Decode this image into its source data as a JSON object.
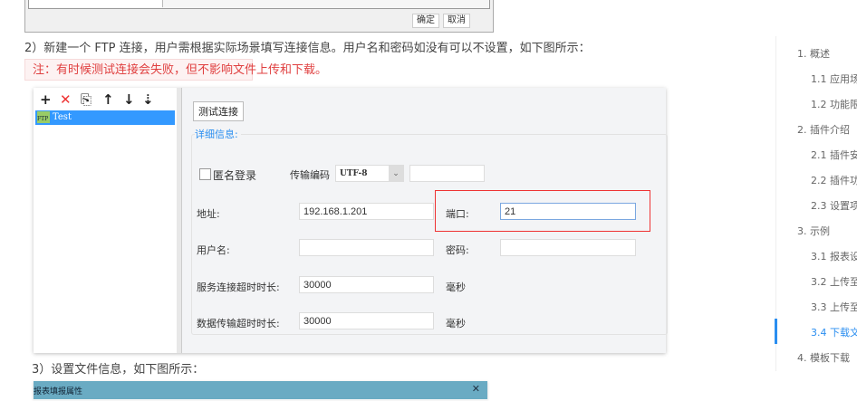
{
  "top_dialog": {
    "ok": "确定",
    "cancel": "取消"
  },
  "step2": "2）新建一个 FTP 连接，用户需根据实际场景填写连接信息。用户名和密码如没有可以不设置，如下图所示：",
  "note": "注：有时候测试连接会失败，但不影响文件上传和下载。",
  "ftp": {
    "toolbar": {
      "add": "+",
      "delete": "✕",
      "copy": "⎘",
      "up": "↑",
      "down": "↓",
      "sort": "⇣"
    },
    "connection": "Test",
    "ftp_badge": "FTP",
    "test_button": "测试连接",
    "section": "详细信息:",
    "anonymous": "匿名登录",
    "encoding_label": "传输编码",
    "encoding_value": "UTF-8",
    "address_label": "地址:",
    "address": "192.168.1.201",
    "port_label": "端口:",
    "port": "21",
    "user_label": "用户名:",
    "password_label": "密码:",
    "conn_timeout_label": "服务连接超时时长:",
    "conn_timeout": "30000",
    "data_timeout_label": "数据传输超时时长:",
    "data_timeout": "30000",
    "ms": "毫秒"
  },
  "step3": "3）设置文件信息，如下图所示：",
  "bottom_dialog": {
    "title": "报表填报属性",
    "close": "✕"
  },
  "toc": [
    {
      "label": "1. 概述",
      "level": 1
    },
    {
      "label": "1.1 应用场",
      "level": 2
    },
    {
      "label": "1.2 功能限",
      "level": 2
    },
    {
      "label": "2. 插件介绍",
      "level": 1
    },
    {
      "label": "2.1 插件安",
      "level": 2
    },
    {
      "label": "2.2 插件功",
      "level": 2
    },
    {
      "label": "2.3 设置项",
      "level": 2
    },
    {
      "label": "3. 示例",
      "level": 1
    },
    {
      "label": "3.1 报表设",
      "level": 2
    },
    {
      "label": "3.2 上传至",
      "level": 2
    },
    {
      "label": "3.3 上传至",
      "level": 2
    },
    {
      "label": "3.4 下载文",
      "level": 2,
      "active": true
    },
    {
      "label": "4. 模板下载",
      "level": 1
    }
  ],
  "colors": {
    "accent": "#2a8ef0",
    "note": "#e04040",
    "select": "#3399ff",
    "titlebar": "#6aabc3"
  }
}
